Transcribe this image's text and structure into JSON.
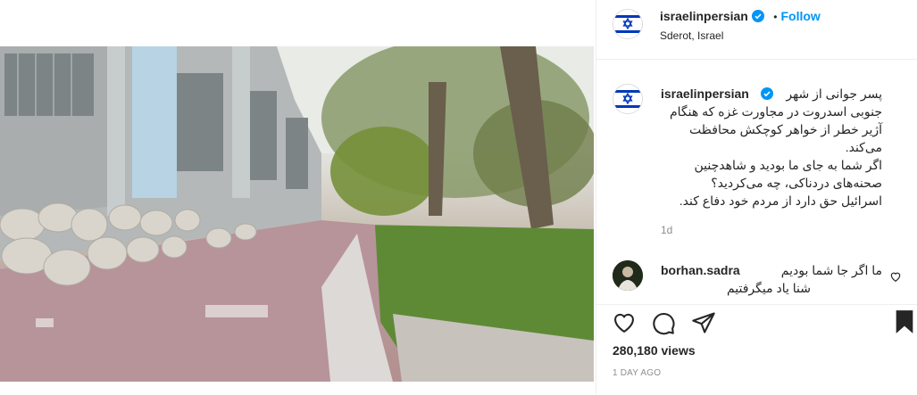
{
  "post": {
    "username": "israelinpersian",
    "follow_separator": "•",
    "follow_label": "Follow",
    "location": "Sderot, Israel"
  },
  "caption": {
    "username": "israelinpersian",
    "lines": [
      "پسر جوانی از شهر",
      "جنوبی اسدروت در مجاورت غزه که هنگام",
      "آژیر خطر از خواهر کوچکش محافظت",
      "می‌کند.",
      "اگر شما به جای ما بودید و شاهدچنین",
      "صحنه‌های دردناکی، چه می‌کردید؟",
      "اسرائیل حق دارد از مردم خود دفاع کند."
    ],
    "time": "1d"
  },
  "comment": {
    "username": "borhan.sadra",
    "text": "ما اگر جا شما بودیم",
    "text2": "شنا یاد میگرفتیم"
  },
  "stats": {
    "views": "280,180 views",
    "posted": "1 DAY AGO"
  },
  "icons": {
    "verified": "verified-badge-icon",
    "mute": "speaker-muted-icon",
    "like": "heart-icon",
    "comment": "comment-bubble-icon",
    "share": "paper-plane-icon",
    "save": "bookmark-icon"
  },
  "colors": {
    "accent": "#0095f6",
    "israel_blue": "#0038b8",
    "muted_text": "#8e8e8e"
  }
}
